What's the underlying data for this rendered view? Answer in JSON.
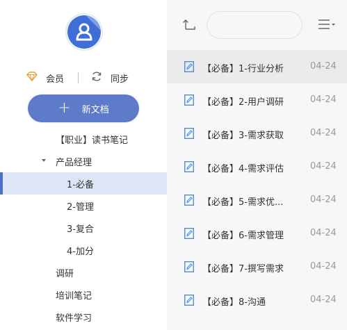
{
  "sidebar": {
    "member_label": "会员",
    "sync_label": "同步",
    "new_doc_plus": "+",
    "new_doc_label": "新文档",
    "tree": [
      {
        "label": "【职业】读书笔记",
        "indent": 1
      },
      {
        "label": "产品经理",
        "indent": 1,
        "expanded": true
      },
      {
        "label": "1-必备",
        "indent": 2,
        "selected": true
      },
      {
        "label": "2-管理",
        "indent": 2
      },
      {
        "label": "3-复合",
        "indent": 2
      },
      {
        "label": "4-加分",
        "indent": 2
      },
      {
        "label": "调研",
        "indent": 0
      },
      {
        "label": "培训笔记",
        "indent": 0
      },
      {
        "label": "软件学习",
        "indent": 0
      }
    ]
  },
  "main": {
    "search": {
      "placeholder": "",
      "value": ""
    },
    "documents": [
      {
        "title": "【必备】1-行业分析",
        "date": "04-24",
        "selected": true
      },
      {
        "title": "【必备】2-用户调研",
        "date": "04-24"
      },
      {
        "title": "【必备】3-需求获取",
        "date": "04-24"
      },
      {
        "title": "【必备】4-需求评估",
        "date": "04-24"
      },
      {
        "title": "【必备】5-需求优...",
        "date": "04-24"
      },
      {
        "title": "【必备】6-需求管理",
        "date": "04-24"
      },
      {
        "title": "【必备】7-撰写需求",
        "date": "04-24"
      },
      {
        "title": "【必备】8-沟通",
        "date": "04-24"
      }
    ]
  },
  "colors": {
    "accent": "#5d7bc9",
    "selected_tree_bg": "#dde6f7",
    "selected_tree_bar": "#4a6fc3",
    "panel_bg": "#f7f7f7",
    "doc_icon": "#4a8fd9",
    "vip_icon": "#e6a23c"
  },
  "icons": {
    "avatar": "user-avatar-icon",
    "member": "diamond-icon",
    "sync": "sync-icon",
    "up": "up-folder-icon",
    "menu": "list-menu-icon",
    "doc": "document-edit-icon"
  }
}
